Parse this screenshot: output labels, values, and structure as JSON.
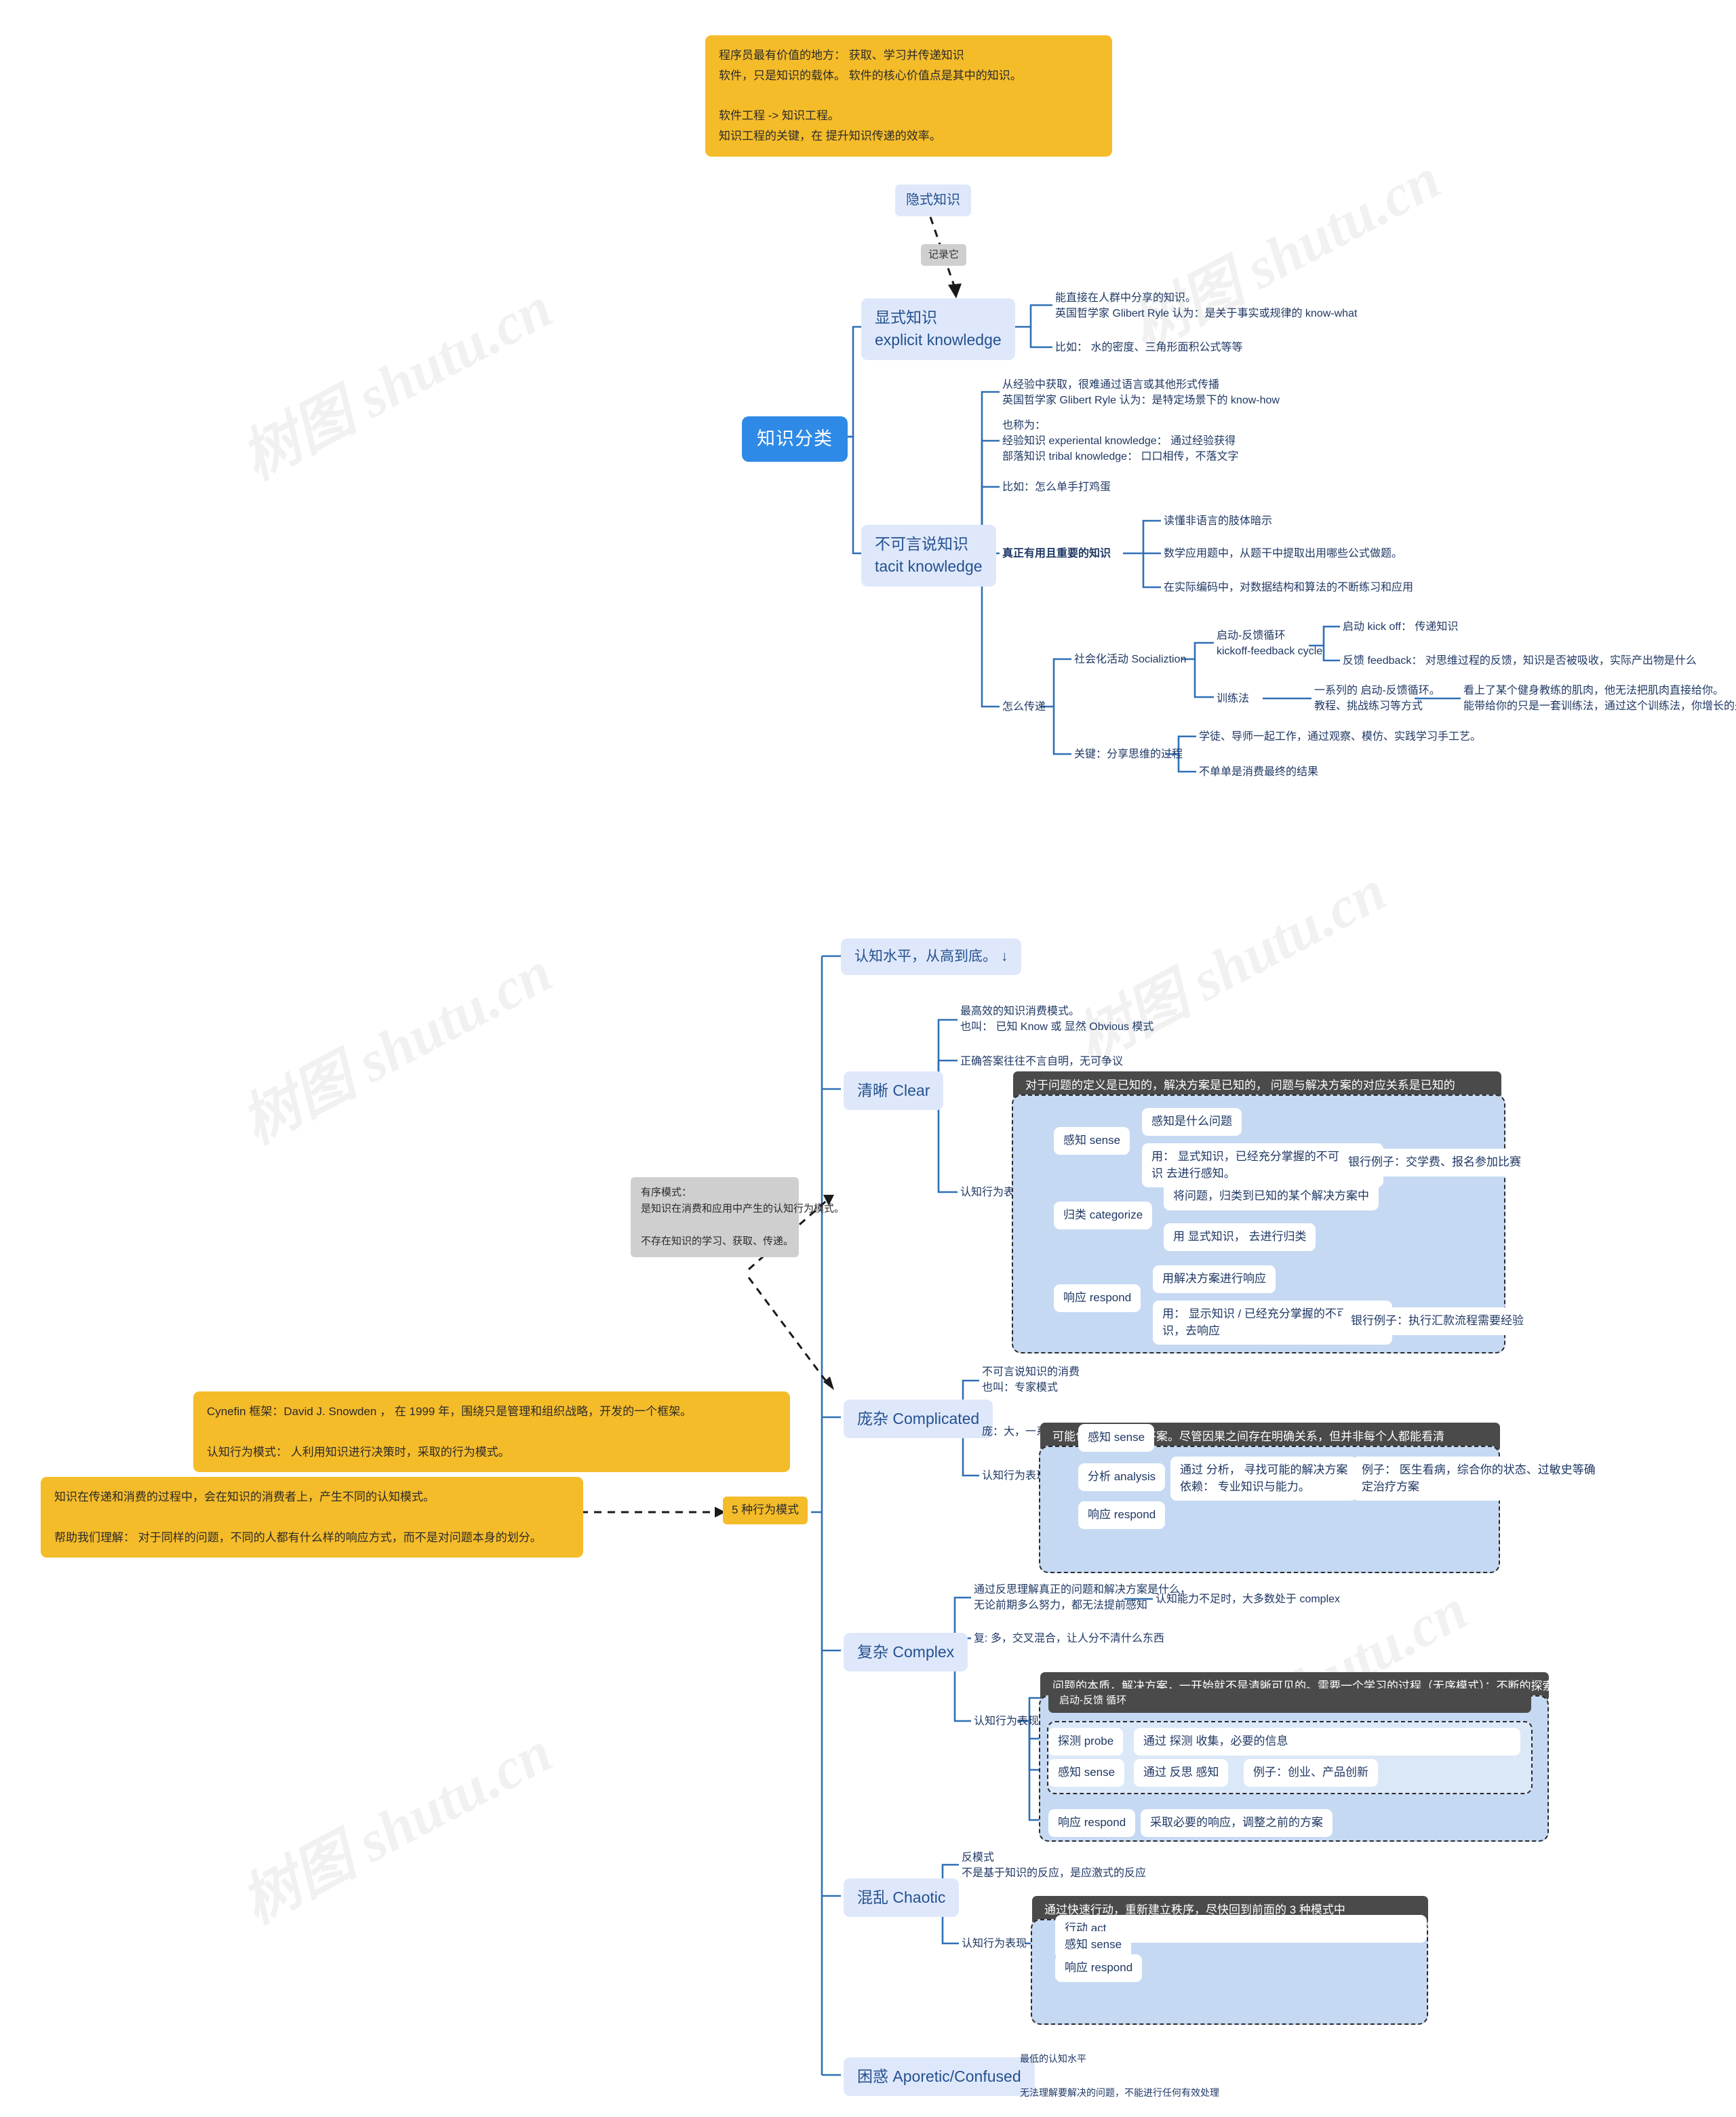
{
  "watermarks": [
    "树图 shutu.cn",
    "树图 shutu.cn",
    "树图 shutu.cn",
    "树图 shutu.cn",
    "树图 shutu.cn",
    "树图 shutu.cn"
  ],
  "top_note": "程序员最有价值的地方： 获取、学习并传递知识\n软件，只是知识的载体。 软件的核心价值点是其中的知识。\n\n软件工程 -> 知识工程。\n知识工程的关键，在 提升知识传递的效率。",
  "map1": {
    "floating_node": "隐式知识",
    "edge_label": "记录它",
    "root": "知识分类",
    "explicit": {
      "label": "显式知识\nexplicit knowledge",
      "children": [
        "能直接在人群中分享的知识。\n英国哲学家 Glibert Ryle 认为：是关于事实或规律的 know-what",
        "比如： 水的密度、三角形面积公式等等"
      ]
    },
    "tacit": {
      "label": "不可言说知识\ntacit knowledge",
      "children": [
        "从经验中获取，很难通过语言或其他形式传播\n英国哲学家 Glibert Ryle 认为：是特定场景下的 know-how",
        "也称为：\n经验知识 experiental knowledge： 通过经验获得\n部落知识 tribal knowledge： 口口相传，不落文字",
        "比如：怎么单手打鸡蛋"
      ],
      "important": {
        "label": "真正有用且重要的知识",
        "items": [
          "读懂非语言的肢体暗示",
          "数学应用题中，从题干中提取出用哪些公式做题。",
          "在实际编码中，对数据结构和算法的不断练习和应用"
        ]
      },
      "transfer": {
        "label": "怎么传递",
        "social": {
          "label": "社会化活动 Socializtion",
          "cycle": {
            "label": "启动-反馈循环\nkickoff-feedback cycle",
            "items": [
              "启动 kick off： 传递知识",
              "反馈 feedback： 对思维过程的反馈，知识是否被吸收，实际产出物是什么"
            ]
          },
          "training": {
            "label": "训练法",
            "detail": "一系列的 启动-反馈循环。\n教程、挑战练习等方式",
            "example": "看上了某个健身教练的肌肉，他无法把肌肉直接给你。\n能带给你的只是一套训练法，通过这个训练法，你增长的是自己的肌肉。"
          }
        },
        "key": {
          "label": "关键：分享思维的过程",
          "items": [
            "学徒、导师一起工作，通过观察、模仿、实践学习手工艺。",
            "不单单是消费最终的结果"
          ]
        }
      }
    }
  },
  "map2": {
    "root": "5 种行为模式",
    "left_note_1": "Cynefin 框架：David J. Snowden ， 在 1999 年，围绕只是管理和组织战略，开发的一个框架。\n\n认知行为模式： 人利用知识进行决策时，采取的行为模式。",
    "left_note_2": "知识在传递和消费的过程中，会在知识的消费者上，产生不同的认知模式。\n\n帮助我们理解： 对于同样的问题，不同的人都有什么样的响应方式，而不是对问题本身的划分。",
    "gray_note": "有序模式：\n是知识在消费和应用中产生的认知行为模式。\n\n不存在知识的学习、获取、传递。",
    "header": "认知水平，从高到底。 ↓",
    "clear": {
      "label": "清晰 Clear",
      "notes": [
        "最高效的知识消费模式。\n也叫： 已知 Know 或 显然 Obvious 模式",
        "正确答案往往不言自明，无可争议"
      ],
      "behavior_label": "认知行为表现",
      "banner": "对于问题的定义是已知的，解决方案是已知的， 问题与解决方案的对应关系是已知的",
      "rows": [
        {
          "name": "感知 sense",
          "items": [
            "感知是什么问题",
            "用： 显式知识，已经充分掌握的不可言说知\n识 去进行感知。"
          ],
          "example": "银行例子：交学费、报名参加比赛"
        },
        {
          "name": "归类 categorize",
          "items": [
            "将问题，归类到已知的某个解决方案中",
            "用 显式知识， 去进行归类"
          ],
          "example": ""
        },
        {
          "name": "响应 respond",
          "items": [
            "用解决方案进行响应",
            "用： 显示知识 / 已经充分掌握的不可言说知\n识，去响应"
          ],
          "example": "银行例子：执行汇款流程需要经验"
        }
      ]
    },
    "complicated": {
      "label": "庞杂 Complicated",
      "notes": [
        "不可言说知识的消费\n也叫：专家模式",
        "庞：大，一系列简单的堆叠，多个清晰模式的组合"
      ],
      "behavior_label": "认知行为表现",
      "banner": "可能包含多个正确答案。尽管因果之间存在明确关系，但并非每个人都能看清",
      "rows": [
        {
          "name": "感知 sense",
          "detail": "",
          "example": ""
        },
        {
          "name": "分析 analysis",
          "detail": "通过 分析， 寻找可能的解决方案\n依赖： 专业知识与能力。",
          "example": "例子： 医生看病，综合你的状态、过敏史等确\n定治疗方案"
        },
        {
          "name": "响应 respond",
          "detail": "",
          "example": ""
        }
      ]
    },
    "complex": {
      "label": "复杂 Complex",
      "notes": [
        "通过反思理解真正的问题和解决方案是什么，\n无论前期多么努力，都无法提前感知",
        "复: 多，交叉混合，让人分不清什么东西"
      ],
      "note_side": "认知能力不足时，大多数处于 complex",
      "behavior_label": "认知行为表现",
      "banner": "问题的本质，解决方案，一开始就不是清晰可见的。需要一个学习的过程（无序模式）：不断的探索和适应",
      "cycle_title": "启动-反馈 循环",
      "cycle_rows": [
        {
          "name": "探测 probe",
          "detail": "通过 探测 收集，必要的信息",
          "example": ""
        },
        {
          "name": "感知 sense",
          "detail": "通过 反思 感知",
          "example": "例子：创业、产品创新"
        }
      ],
      "respond": {
        "name": "响应 respond",
        "detail": "采取必要的响应，调整之前的方案"
      }
    },
    "chaotic": {
      "label": "混乱 Chaotic",
      "notes": [
        "反模式\n不是基于知识的反应，是应激式的反应"
      ],
      "behavior_label": "认知行为表现",
      "banner": "通过快速行动，重新建立秩序，尽快回到前面的 3 种模式中",
      "rows": [
        "行动 act",
        "感知 sense",
        "响应 respond"
      ]
    },
    "confused": {
      "label": "困惑 Aporetic/Confused",
      "notes": [
        "最低的认知水平",
        "无法理解要解决的问题，不能进行任何有效处理"
      ]
    }
  },
  "colors": {
    "accent_blue": "#2e8ae6",
    "node_blue": "#dfe8fb",
    "yellow": "#f5bc2a",
    "gray": "#cfcfcf",
    "dark": "#4a4a4a",
    "link": "#2f6fb5"
  }
}
